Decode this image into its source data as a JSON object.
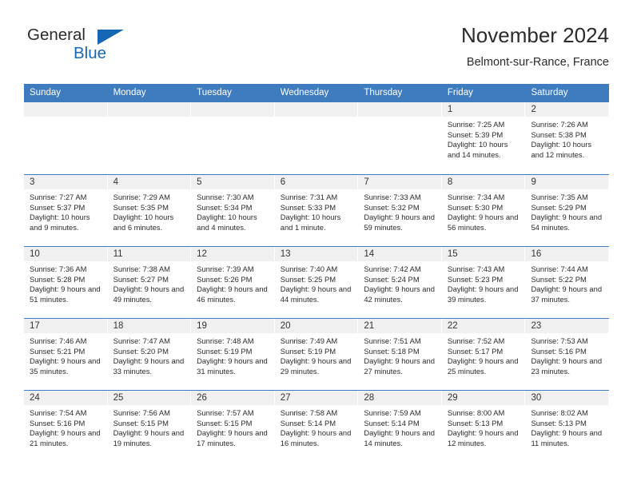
{
  "brand": {
    "name_part1": "General",
    "name_part2": "Blue",
    "accent_color": "#1567b3"
  },
  "header": {
    "title": "November 2024",
    "subtitle": "Belmont-sur-Rance, France",
    "header_bg_color": "#3f7cbf"
  },
  "weekdays": [
    "Sunday",
    "Monday",
    "Tuesday",
    "Wednesday",
    "Thursday",
    "Friday",
    "Saturday"
  ],
  "weeks": [
    [
      {
        "day": "",
        "empty": true,
        "sunrise": "",
        "sunset": "",
        "daylight": ""
      },
      {
        "day": "",
        "empty": true,
        "sunrise": "",
        "sunset": "",
        "daylight": ""
      },
      {
        "day": "",
        "empty": true,
        "sunrise": "",
        "sunset": "",
        "daylight": ""
      },
      {
        "day": "",
        "empty": true,
        "sunrise": "",
        "sunset": "",
        "daylight": ""
      },
      {
        "day": "",
        "empty": true,
        "sunrise": "",
        "sunset": "",
        "daylight": ""
      },
      {
        "day": "1",
        "empty": false,
        "sunrise": "Sunrise: 7:25 AM",
        "sunset": "Sunset: 5:39 PM",
        "daylight": "Daylight: 10 hours and 14 minutes."
      },
      {
        "day": "2",
        "empty": false,
        "sunrise": "Sunrise: 7:26 AM",
        "sunset": "Sunset: 5:38 PM",
        "daylight": "Daylight: 10 hours and 12 minutes."
      }
    ],
    [
      {
        "day": "3",
        "empty": false,
        "sunrise": "Sunrise: 7:27 AM",
        "sunset": "Sunset: 5:37 PM",
        "daylight": "Daylight: 10 hours and 9 minutes."
      },
      {
        "day": "4",
        "empty": false,
        "sunrise": "Sunrise: 7:29 AM",
        "sunset": "Sunset: 5:35 PM",
        "daylight": "Daylight: 10 hours and 6 minutes."
      },
      {
        "day": "5",
        "empty": false,
        "sunrise": "Sunrise: 7:30 AM",
        "sunset": "Sunset: 5:34 PM",
        "daylight": "Daylight: 10 hours and 4 minutes."
      },
      {
        "day": "6",
        "empty": false,
        "sunrise": "Sunrise: 7:31 AM",
        "sunset": "Sunset: 5:33 PM",
        "daylight": "Daylight: 10 hours and 1 minute."
      },
      {
        "day": "7",
        "empty": false,
        "sunrise": "Sunrise: 7:33 AM",
        "sunset": "Sunset: 5:32 PM",
        "daylight": "Daylight: 9 hours and 59 minutes."
      },
      {
        "day": "8",
        "empty": false,
        "sunrise": "Sunrise: 7:34 AM",
        "sunset": "Sunset: 5:30 PM",
        "daylight": "Daylight: 9 hours and 56 minutes."
      },
      {
        "day": "9",
        "empty": false,
        "sunrise": "Sunrise: 7:35 AM",
        "sunset": "Sunset: 5:29 PM",
        "daylight": "Daylight: 9 hours and 54 minutes."
      }
    ],
    [
      {
        "day": "10",
        "empty": false,
        "sunrise": "Sunrise: 7:36 AM",
        "sunset": "Sunset: 5:28 PM",
        "daylight": "Daylight: 9 hours and 51 minutes."
      },
      {
        "day": "11",
        "empty": false,
        "sunrise": "Sunrise: 7:38 AM",
        "sunset": "Sunset: 5:27 PM",
        "daylight": "Daylight: 9 hours and 49 minutes."
      },
      {
        "day": "12",
        "empty": false,
        "sunrise": "Sunrise: 7:39 AM",
        "sunset": "Sunset: 5:26 PM",
        "daylight": "Daylight: 9 hours and 46 minutes."
      },
      {
        "day": "13",
        "empty": false,
        "sunrise": "Sunrise: 7:40 AM",
        "sunset": "Sunset: 5:25 PM",
        "daylight": "Daylight: 9 hours and 44 minutes."
      },
      {
        "day": "14",
        "empty": false,
        "sunrise": "Sunrise: 7:42 AM",
        "sunset": "Sunset: 5:24 PM",
        "daylight": "Daylight: 9 hours and 42 minutes."
      },
      {
        "day": "15",
        "empty": false,
        "sunrise": "Sunrise: 7:43 AM",
        "sunset": "Sunset: 5:23 PM",
        "daylight": "Daylight: 9 hours and 39 minutes."
      },
      {
        "day": "16",
        "empty": false,
        "sunrise": "Sunrise: 7:44 AM",
        "sunset": "Sunset: 5:22 PM",
        "daylight": "Daylight: 9 hours and 37 minutes."
      }
    ],
    [
      {
        "day": "17",
        "empty": false,
        "sunrise": "Sunrise: 7:46 AM",
        "sunset": "Sunset: 5:21 PM",
        "daylight": "Daylight: 9 hours and 35 minutes."
      },
      {
        "day": "18",
        "empty": false,
        "sunrise": "Sunrise: 7:47 AM",
        "sunset": "Sunset: 5:20 PM",
        "daylight": "Daylight: 9 hours and 33 minutes."
      },
      {
        "day": "19",
        "empty": false,
        "sunrise": "Sunrise: 7:48 AM",
        "sunset": "Sunset: 5:19 PM",
        "daylight": "Daylight: 9 hours and 31 minutes."
      },
      {
        "day": "20",
        "empty": false,
        "sunrise": "Sunrise: 7:49 AM",
        "sunset": "Sunset: 5:19 PM",
        "daylight": "Daylight: 9 hours and 29 minutes."
      },
      {
        "day": "21",
        "empty": false,
        "sunrise": "Sunrise: 7:51 AM",
        "sunset": "Sunset: 5:18 PM",
        "daylight": "Daylight: 9 hours and 27 minutes."
      },
      {
        "day": "22",
        "empty": false,
        "sunrise": "Sunrise: 7:52 AM",
        "sunset": "Sunset: 5:17 PM",
        "daylight": "Daylight: 9 hours and 25 minutes."
      },
      {
        "day": "23",
        "empty": false,
        "sunrise": "Sunrise: 7:53 AM",
        "sunset": "Sunset: 5:16 PM",
        "daylight": "Daylight: 9 hours and 23 minutes."
      }
    ],
    [
      {
        "day": "24",
        "empty": false,
        "sunrise": "Sunrise: 7:54 AM",
        "sunset": "Sunset: 5:16 PM",
        "daylight": "Daylight: 9 hours and 21 minutes."
      },
      {
        "day": "25",
        "empty": false,
        "sunrise": "Sunrise: 7:56 AM",
        "sunset": "Sunset: 5:15 PM",
        "daylight": "Daylight: 9 hours and 19 minutes."
      },
      {
        "day": "26",
        "empty": false,
        "sunrise": "Sunrise: 7:57 AM",
        "sunset": "Sunset: 5:15 PM",
        "daylight": "Daylight: 9 hours and 17 minutes."
      },
      {
        "day": "27",
        "empty": false,
        "sunrise": "Sunrise: 7:58 AM",
        "sunset": "Sunset: 5:14 PM",
        "daylight": "Daylight: 9 hours and 16 minutes."
      },
      {
        "day": "28",
        "empty": false,
        "sunrise": "Sunrise: 7:59 AM",
        "sunset": "Sunset: 5:14 PM",
        "daylight": "Daylight: 9 hours and 14 minutes."
      },
      {
        "day": "29",
        "empty": false,
        "sunrise": "Sunrise: 8:00 AM",
        "sunset": "Sunset: 5:13 PM",
        "daylight": "Daylight: 9 hours and 12 minutes."
      },
      {
        "day": "30",
        "empty": false,
        "sunrise": "Sunrise: 8:02 AM",
        "sunset": "Sunset: 5:13 PM",
        "daylight": "Daylight: 9 hours and 11 minutes."
      }
    ]
  ]
}
